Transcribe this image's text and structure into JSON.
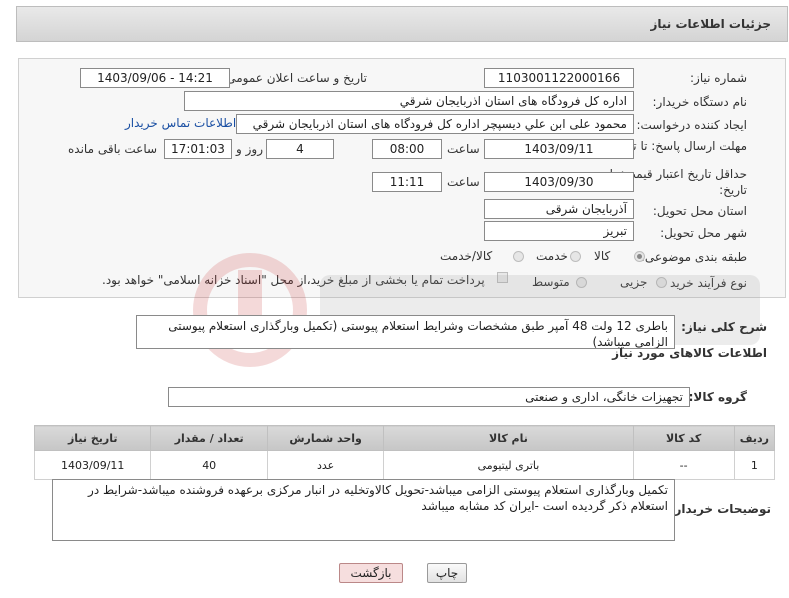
{
  "header": {
    "title": "جزئیات اطلاعات نیاز"
  },
  "form": {
    "need_number_label": "شماره نیاز:",
    "need_number": "1103001122000166",
    "announce_label": "تاریخ و ساعت اعلان عمومی:",
    "announce_value": "1403/09/06 - 14:21",
    "buyer_org_label": "نام دستگاه خریدار:",
    "buyer_org": "اداره کل فرودگاه های استان اذربایجان شرقي",
    "creator_label": "ایجاد کننده درخواست:",
    "creator": "محمود علی ابن علي ديسپچر اداره کل فرودگاه های استان اذربایجان شرقي",
    "contact_link": "اطلاعات تماس خریدار",
    "deadline_label": "مهلت ارسال پاسخ: تا تاریخ:",
    "deadline_date": "1403/09/11",
    "time_label": "ساعت",
    "deadline_time": "08:00",
    "days_value": "4",
    "days_label": "روز و",
    "remaining_time": "17:01:03",
    "remaining_label": "ساعت باقی مانده",
    "validity_label": "حداقل تاریخ اعتبار قیمت: تا تاریخ:",
    "validity_date": "1403/09/30",
    "validity_time": "11:11",
    "province_label": "استان محل تحویل:",
    "province": "آذربایجان شرقی",
    "city_label": "شهر محل تحویل:",
    "city": "تبریز",
    "category_label": "طبقه بندی موضوعی:",
    "category_options": [
      "کالا",
      "خدمت",
      "کالا/خدمت"
    ],
    "process_label": "نوع فرآیند خرید :",
    "process_options": [
      "جزیی",
      "متوسط"
    ],
    "payment_note": "پرداخت تمام یا بخشی از مبلغ خرید،از محل \"اسناد خزانه اسلامی\" خواهد بود."
  },
  "description": {
    "label": "شرح کلی نیاز:",
    "text": "باطری 12 ولت 48 آمپر طبق مشخصات وشرایط استعلام پیوستی (تکمیل وبارگذاری استعلام پیوستی الزامی میباشد)"
  },
  "goods": {
    "section_title": "اطلاعات کالاهای مورد نیاز",
    "group_label": "گروه کالا:",
    "group_value": "تجهیزات خانگی، اداری و صنعتی",
    "columns": [
      "ردیف",
      "کد کالا",
      "نام کالا",
      "واحد شمارش",
      "تعداد / مقدار",
      "تاریخ نیاز"
    ],
    "rows": [
      {
        "index": "1",
        "code": "--",
        "name": "باتری لیتیومی",
        "unit": "عدد",
        "qty": "40",
        "date": "1403/09/11"
      }
    ]
  },
  "buyer_notes": {
    "label": "توضیحات خریدار:",
    "text": "تکمیل وبارگذاری استعلام پیوستی الزامی میباشد-تحویل کالاوتخلیه در انبار مرکزی برعهده فروشنده میباشد-شرایط در استعلام ذکر گردیده است -ایران کد مشابه میباشد"
  },
  "buttons": {
    "print": "چاپ",
    "back": "بازگشت"
  },
  "colors": {
    "link": "#1a4fa3",
    "back_button_bg": "#f6dede"
  }
}
